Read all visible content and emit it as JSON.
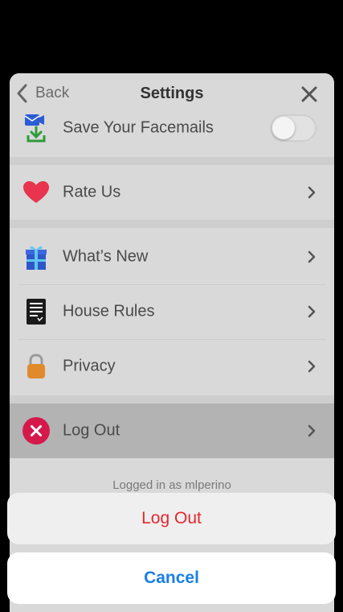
{
  "nav": {
    "back_label": "Back",
    "title": "Settings"
  },
  "rows": {
    "save_facemails": {
      "label": "Save Your Facemails",
      "toggle_on": false
    },
    "rate_us": {
      "label": "Rate Us"
    },
    "whats_new": {
      "label": "What’s New"
    },
    "house_rules": {
      "label": "House Rules"
    },
    "privacy": {
      "label": "Privacy"
    },
    "log_out": {
      "label": "Log Out"
    }
  },
  "footer": {
    "logged_in_text": "Logged in as mlperino"
  },
  "action_sheet": {
    "confirm_label": "Log Out",
    "cancel_label": "Cancel"
  },
  "colors": {
    "destructive": "#e5262e",
    "cancel": "#1a7fe6",
    "heart": "#e8344e",
    "logout_icon": "#d6194b"
  }
}
